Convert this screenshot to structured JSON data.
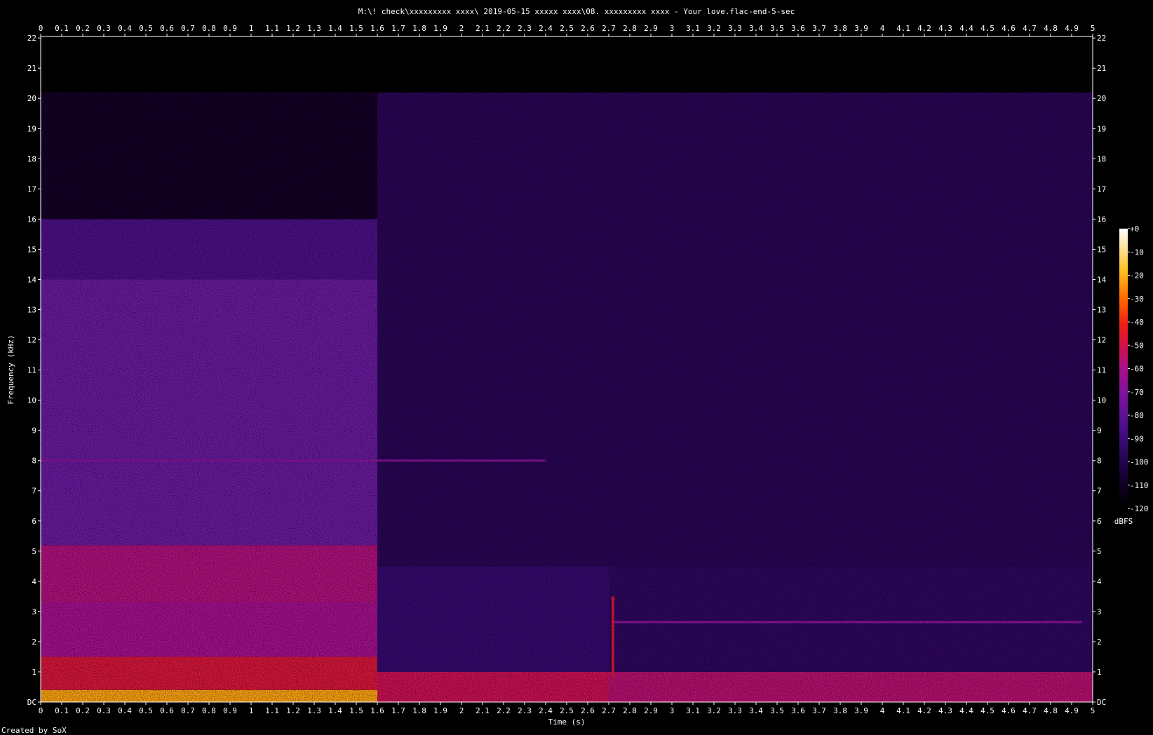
{
  "chart_data": {
    "type": "heatmap",
    "title": "M:\\! check\\xxxxxxxxx xxxx\\ 2019-05-15  xxxxx xxxx\\08. xxxxxxxxx xxxx - Your love.flac-end-5-sec",
    "xlabel": "Time (s)",
    "ylabel": "Frequency (kHz)",
    "colorbar_label": "dBFS",
    "credit": "Created by SoX",
    "xlim": [
      0,
      5
    ],
    "ylim": [
      0,
      22.05
    ],
    "x_ticks": [
      "0",
      "0.1",
      "0.2",
      "0.3",
      "0.4",
      "0.5",
      "0.6",
      "0.7",
      "0.8",
      "0.9",
      "1",
      "1.1",
      "1.2",
      "1.3",
      "1.4",
      "1.5",
      "1.6",
      "1.7",
      "1.8",
      "1.9",
      "2",
      "2.1",
      "2.2",
      "2.3",
      "2.4",
      "2.5",
      "2.6",
      "2.7",
      "2.8",
      "2.9",
      "3",
      "3.1",
      "3.2",
      "3.3",
      "3.4",
      "3.5",
      "3.6",
      "3.7",
      "3.8",
      "3.9",
      "4",
      "4.1",
      "4.2",
      "4.3",
      "4.4",
      "4.5",
      "4.6",
      "4.7",
      "4.8",
      "4.9",
      "5"
    ],
    "y_ticks": [
      "DC",
      "1",
      "2",
      "3",
      "4",
      "5",
      "6",
      "7",
      "8",
      "9",
      "10",
      "11",
      "12",
      "13",
      "14",
      "15",
      "16",
      "17",
      "18",
      "19",
      "20",
      "21",
      "22"
    ],
    "colorbar_ticks": [
      "+0",
      "-10",
      "-20",
      "-30",
      "-40",
      "-50",
      "-60",
      "-70",
      "-80",
      "-90",
      "-100",
      "-110",
      "-120"
    ],
    "colorbar_range_dbfs": [
      -120,
      0
    ],
    "colormap_stops": [
      "#000000",
      "#1a0033",
      "#3a0a7a",
      "#6a1aa0",
      "#a0109a",
      "#d4104a",
      "#f02810",
      "#ff7a00",
      "#ffd020",
      "#ffffff"
    ],
    "regions": [
      {
        "t": [
          0,
          1.6
        ],
        "f_khz": [
          0,
          0.4
        ],
        "dbfs": -20
      },
      {
        "t": [
          0,
          1.6
        ],
        "f_khz": [
          0.4,
          1.5
        ],
        "dbfs": -50
      },
      {
        "t": [
          0,
          1.6
        ],
        "f_khz": [
          1.5,
          3.3
        ],
        "dbfs": -65
      },
      {
        "t": [
          0,
          1.6
        ],
        "f_khz": [
          3.3,
          5.2
        ],
        "dbfs": -62
      },
      {
        "t": [
          0,
          1.6
        ],
        "f_khz": [
          5.2,
          14
        ],
        "dbfs": -80
      },
      {
        "t": [
          0,
          1.6
        ],
        "f_khz": [
          14,
          16
        ],
        "dbfs": -88
      },
      {
        "t": [
          0,
          1.6
        ],
        "f_khz": [
          16,
          20.2
        ],
        "dbfs": -110
      },
      {
        "t": [
          1.6,
          2.7
        ],
        "f_khz": [
          0,
          1
        ],
        "dbfs": -55
      },
      {
        "t": [
          1.6,
          2.7
        ],
        "f_khz": [
          1,
          4.5
        ],
        "dbfs": -95
      },
      {
        "t": [
          1.6,
          5
        ],
        "f_khz": [
          4.5,
          20.2
        ],
        "dbfs": -100
      },
      {
        "t": [
          2.7,
          5
        ],
        "f_khz": [
          0,
          1
        ],
        "dbfs": -60
      },
      {
        "t": [
          2.7,
          5
        ],
        "f_khz": [
          1,
          4.5
        ],
        "dbfs": -98
      },
      {
        "t": [
          0,
          5
        ],
        "f_khz": [
          20.2,
          22.05
        ],
        "dbfs": -130
      }
    ],
    "features": [
      {
        "kind": "tone",
        "t": [
          2.72,
          4.95
        ],
        "f_khz": 2.65,
        "dbfs": -70
      },
      {
        "kind": "tone",
        "t": [
          0,
          2.4
        ],
        "f_khz": 8.0,
        "dbfs": -72
      },
      {
        "kind": "transient",
        "t": 2.72,
        "f_khz": [
          0.8,
          3.5
        ],
        "dbfs": -50
      }
    ]
  }
}
